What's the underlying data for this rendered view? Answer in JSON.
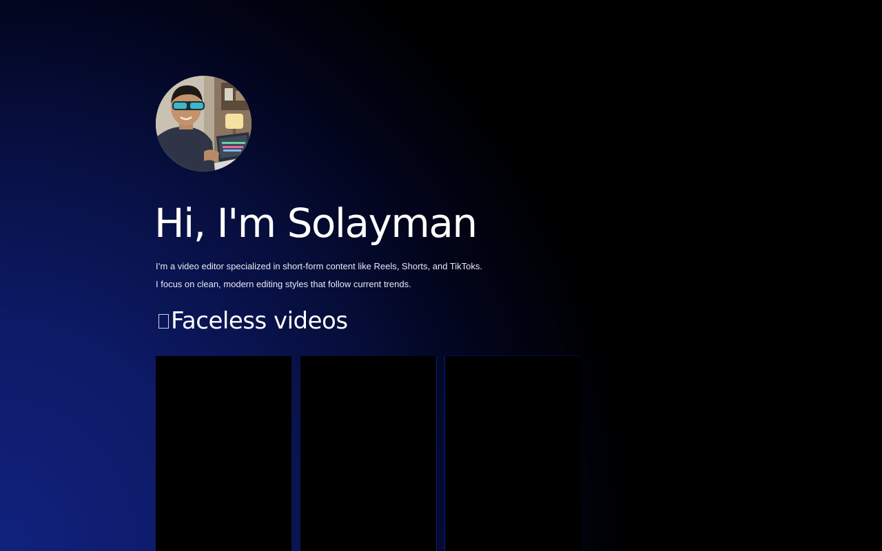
{
  "hero": {
    "avatar_alt": "Solayman profile photo",
    "title": "Hi, I'm Solayman",
    "intro_line_1": "I’m a video editor specialized in short-form content like Reels, Shorts, and TikToks.",
    "intro_line_2": "I focus on clean, modern editing styles that follow current trends."
  },
  "section": {
    "icon": "missing-glyph-icon",
    "title": "Faceless videos"
  },
  "videos": [
    {
      "icon": "video-player"
    },
    {
      "icon": "video-player"
    },
    {
      "icon": "video-player"
    }
  ],
  "colors": {
    "background_gradient_start": "#11227e",
    "background_gradient_end": "#000000",
    "text": "#ffffff",
    "video_card": "#000000"
  }
}
